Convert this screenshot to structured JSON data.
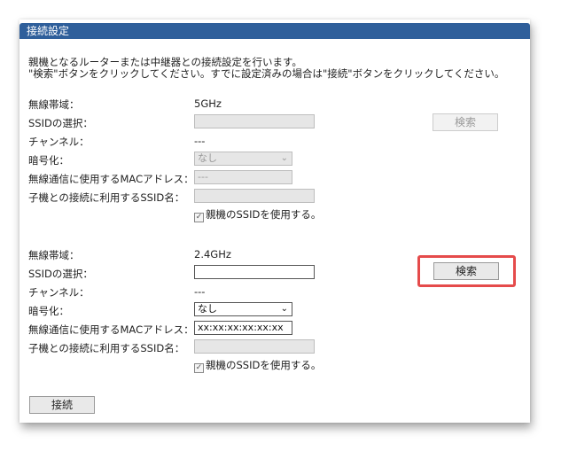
{
  "panel": {
    "title": "接続設定",
    "desc_line1": "親機となるルーターまたは中継器との接続設定を行います。",
    "desc_line2": "\"検索\"ボタンをクリックしてください。すでに設定済みの場合は\"接続\"ボタンをクリックしてください。"
  },
  "labels": {
    "band": "無線帯域：",
    "ssid_select": "SSIDの選択：",
    "channel": "チャンネル：",
    "encryption": "暗号化：",
    "mac": "無線通信に使用するMACアドレス：",
    "child_ssid": "子機との接続に利用するSSID名：",
    "use_parent_ssid": "親機のSSIDを使用する。"
  },
  "band5": {
    "band": "5GHz",
    "channel": "---",
    "encryption": "なし",
    "mac": "---",
    "search_label": "検索"
  },
  "band24": {
    "band": "2.4GHz",
    "channel": "---",
    "encryption": "なし",
    "mac": "xx:xx:xx:xx:xx:xx",
    "search_label": "検索"
  },
  "connect_label": "接続",
  "colors": {
    "title_bg": "#2f5f9b",
    "highlight": "#e54b4b"
  }
}
